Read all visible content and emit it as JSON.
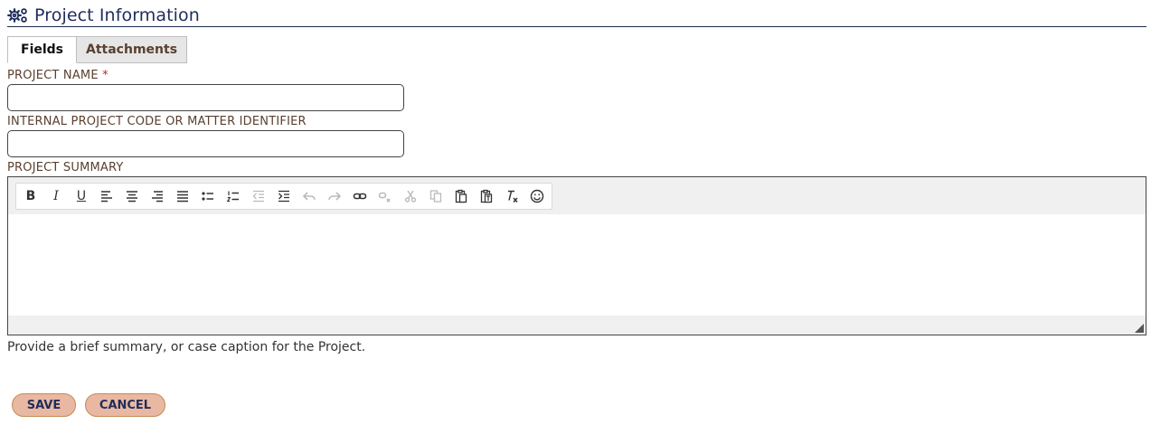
{
  "header": {
    "title": "Project Information",
    "icon": "gears-icon",
    "color": "#1f2d5c"
  },
  "tabs": [
    {
      "label": "Fields",
      "active": true
    },
    {
      "label": "Attachments",
      "active": false
    }
  ],
  "form": {
    "project_name": {
      "label": "PROJECT NAME",
      "required_marker": "*",
      "value": ""
    },
    "project_code": {
      "label": "INTERNAL PROJECT CODE OR MATTER IDENTIFIER",
      "value": ""
    },
    "project_summary": {
      "label": "PROJECT SUMMARY",
      "help": "Provide a brief summary, or case caption for the Project.",
      "toolbar": [
        {
          "icon": "bold-icon",
          "glyph": "B",
          "enabled": true
        },
        {
          "icon": "italic-icon",
          "glyph": "I",
          "enabled": true
        },
        {
          "icon": "underline-icon",
          "glyph": "U",
          "enabled": true
        },
        {
          "icon": "align-left-icon",
          "enabled": true
        },
        {
          "icon": "align-center-icon",
          "enabled": true
        },
        {
          "icon": "align-right-icon",
          "enabled": true
        },
        {
          "icon": "align-justify-icon",
          "enabled": true
        },
        {
          "icon": "bulleted-list-icon",
          "enabled": true
        },
        {
          "icon": "numbered-list-icon",
          "enabled": true
        },
        {
          "icon": "outdent-icon",
          "enabled": false
        },
        {
          "icon": "indent-icon",
          "enabled": true
        },
        {
          "icon": "undo-icon",
          "enabled": false
        },
        {
          "icon": "redo-icon",
          "enabled": false
        },
        {
          "icon": "link-icon",
          "enabled": true
        },
        {
          "icon": "unlink-icon",
          "enabled": false
        },
        {
          "icon": "cut-icon",
          "enabled": false
        },
        {
          "icon": "copy-icon",
          "enabled": false
        },
        {
          "icon": "paste-icon",
          "enabled": true
        },
        {
          "icon": "paste-text-icon",
          "enabled": true
        },
        {
          "icon": "remove-format-icon",
          "enabled": true
        },
        {
          "icon": "emoji-icon",
          "enabled": true
        }
      ]
    }
  },
  "actions": {
    "save_label": "SAVE",
    "cancel_label": "CANCEL"
  },
  "colors": {
    "label": "#5a4030",
    "required": "#c0282a",
    "button_bg": "#e9b8a2",
    "button_border": "#c48a56"
  }
}
